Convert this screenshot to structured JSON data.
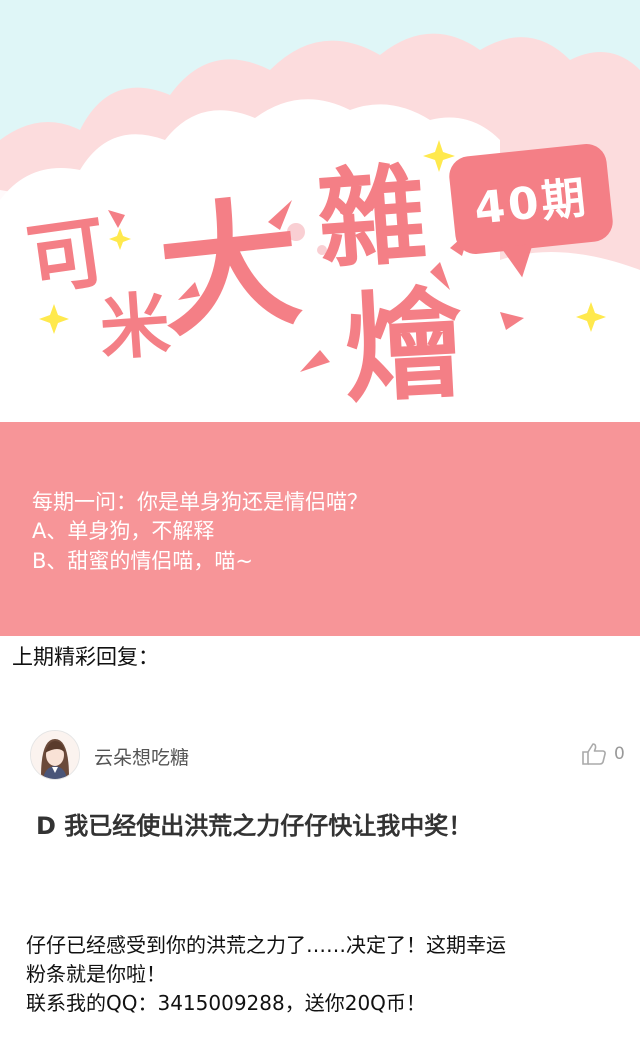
{
  "banner": {
    "title_chars": [
      "可",
      "米",
      "大",
      "雜",
      "燴"
    ],
    "issue_label": "40期",
    "colors": {
      "title": "#f47f86",
      "sky": "#dff6f7",
      "cloud_pink": "#fcdcdd",
      "star": "#ffe94d"
    }
  },
  "question": {
    "line1": "每期一问：你是单身狗还是情侣喵？",
    "line2": "A、单身狗，不解释",
    "line3": "B、甜蜜的情侣喵，喵~",
    "bg_color": "#f79598"
  },
  "previous": {
    "label": "上期精彩回复："
  },
  "comment": {
    "username": "云朵想吃糖",
    "like_count": "0",
    "text": "D 我已经使出洪荒之力仔仔快让我中奖！",
    "avatar_icon": "avatar-girl-icon",
    "like_icon": "thumbs-up-icon"
  },
  "reply": {
    "line1": "仔仔已经感受到你的洪荒之力了……决定了！这期幸运",
    "line2": "粉条就是你啦！",
    "line3": "联系我的QQ：3415009288，送你20Q币！"
  }
}
